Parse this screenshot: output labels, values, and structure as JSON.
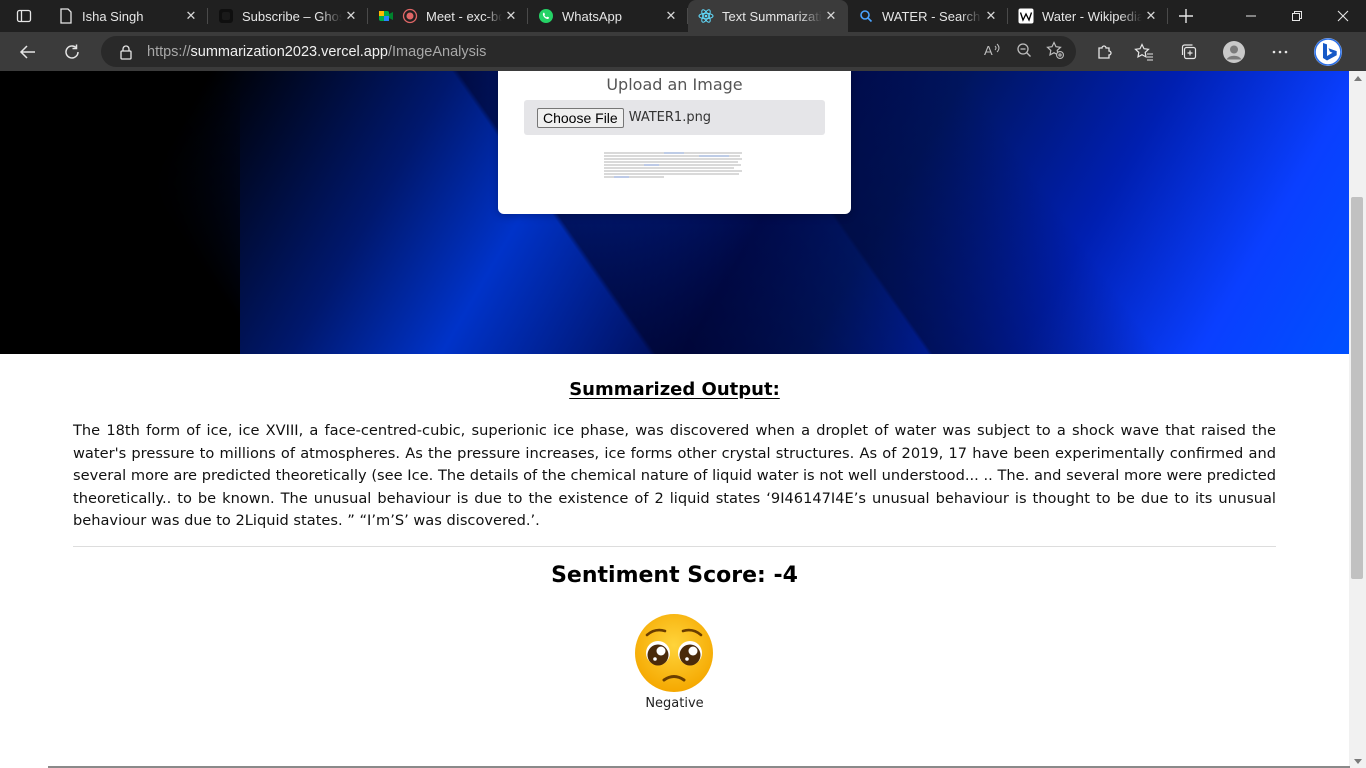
{
  "tabs": [
    {
      "title": "Isha Singh",
      "icon": "document-icon",
      "active": false
    },
    {
      "title": "Subscribe – Ghost",
      "icon": "ghost-icon",
      "active": false
    },
    {
      "title": "Meet - exc-bqkm",
      "icon": "meet-icon",
      "active": false
    },
    {
      "title": "WhatsApp",
      "icon": "whatsapp-icon",
      "active": false
    },
    {
      "title": "Text Summarization",
      "icon": "react-icon",
      "active": true
    },
    {
      "title": "WATER - Search",
      "icon": "search-icon",
      "active": false
    },
    {
      "title": "Water - Wikipedia",
      "icon": "wikipedia-icon",
      "active": false
    }
  ],
  "address": {
    "scheme": "https://",
    "host": "summarization2023.vercel.app",
    "path": "/ImageAnalysis"
  },
  "upload": {
    "title": "Upload an Image",
    "button_label": "Choose File",
    "file_name": "WATER1.png"
  },
  "summary": {
    "heading": "Summarized Output:",
    "text": "The 18th form of ice, ice XVIII, a face-centred-cubic, superionic ice phase, was discovered when a droplet of water was subject to a shock wave that raised the water's pressure to millions of atmospheres. As the pressure increases, ice forms other crystal structures. As of 2019, 17 have been experimentally confirmed and several more are predicted theoretically (see Ice. The details of the chemical nature of liquid water is not well understood...  .. The.  and several more were predicted theoretically.. to be known. The unusual behaviour is due to the existence of 2 liquid states  ‘9I46147I4E’s unusual behaviour is thought to be due to its unusual behaviour was due to  2Liquid states. ” “I’m’S’ was discovered.’."
  },
  "sentiment": {
    "label": "Sentiment Score: -4",
    "emoji_name": "pleading-face-icon",
    "category": "Negative"
  }
}
